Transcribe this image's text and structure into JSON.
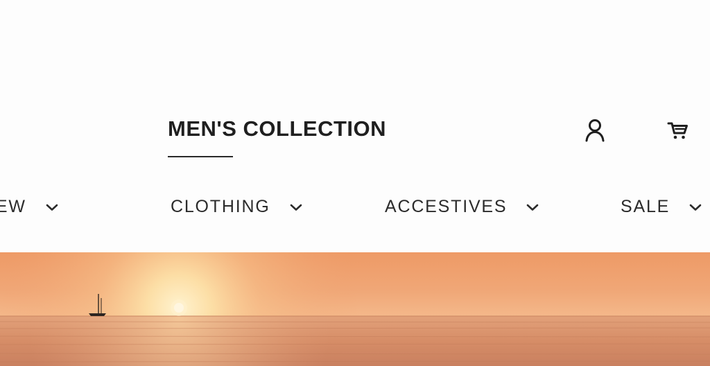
{
  "header": {
    "title": "MEN'S COLLECTION",
    "account_icon": "user-icon",
    "cart_icon": "cart-icon"
  },
  "nav": {
    "items": [
      {
        "label": "NEW",
        "icon": "chevron-down-icon"
      },
      {
        "label": "CLOTHING",
        "icon": "chevron-down-icon"
      },
      {
        "label": "ACCESTIVES",
        "icon": "chevron-down-icon"
      },
      {
        "label": "SALE",
        "icon": "chevron-down-icon"
      }
    ]
  },
  "hero": {
    "image": "sunset-over-sea-with-sailboat"
  },
  "colors": {
    "text": "#1f1f1f",
    "background": "#fdfdfd",
    "sky_top": "#ef9d6b",
    "sky_glow": "#fde3b0",
    "sea": "#d9916a"
  }
}
